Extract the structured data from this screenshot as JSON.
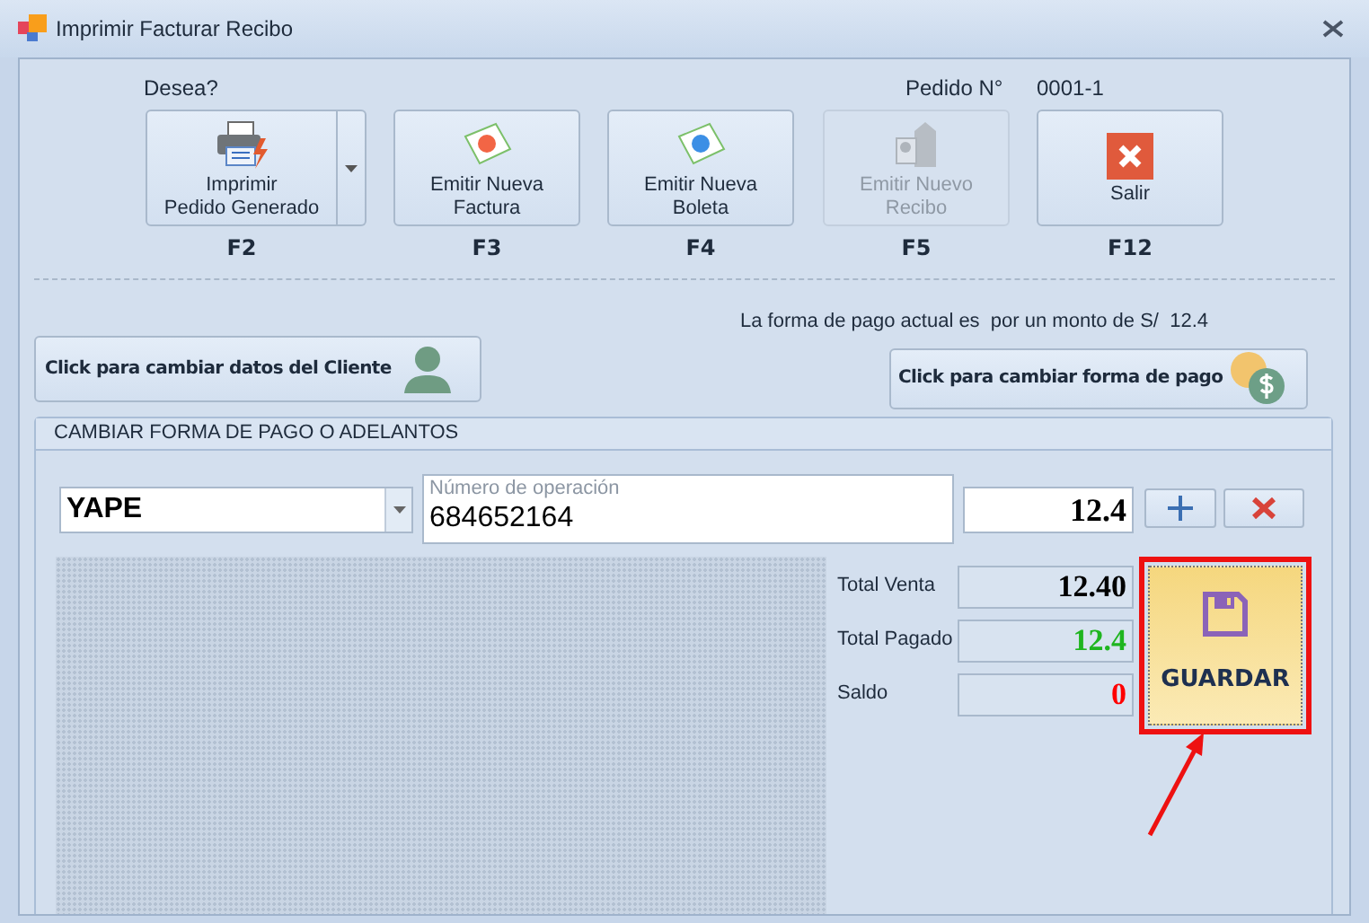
{
  "window": {
    "title": "Imprimir Facturar Recibo"
  },
  "header": {
    "prompt": "Desea?",
    "order_label": "Pedido N°",
    "order_number": "0001-1"
  },
  "actions": [
    {
      "kind": "split",
      "lines": [
        "Imprimir",
        "Pedido Generado"
      ],
      "key": "F2",
      "disabled": false
    },
    {
      "kind": "button",
      "lines": [
        "Emitir Nueva",
        "Factura"
      ],
      "key": "F3",
      "disabled": false
    },
    {
      "kind": "button",
      "lines": [
        "Emitir Nueva",
        "Boleta"
      ],
      "key": "F4",
      "disabled": false
    },
    {
      "kind": "button",
      "lines": [
        "Emitir Nuevo",
        "Recibo"
      ],
      "key": "F5",
      "disabled": true
    },
    {
      "kind": "button",
      "lines": [
        "Salir"
      ],
      "key": "F12",
      "disabled": false
    }
  ],
  "payment_info": "La forma de pago actual es  por un monto de S/  12.4",
  "client_button": "Click para cambiar datos del Cliente",
  "payment_button": "Click para cambiar forma de pago",
  "payment_group": {
    "title": "CAMBIAR FORMA DE PAGO O ADELANTOS",
    "method": "YAPE",
    "operation": {
      "label": "Número de operación",
      "value": "684652164"
    },
    "amount": "12.4",
    "totals": [
      {
        "label": "Total  Venta",
        "value": "12.40",
        "color": "#000000"
      },
      {
        "label": "Total Pagado",
        "value": "12.4",
        "color": "#1fb51f"
      },
      {
        "label": "Saldo",
        "value": "0",
        "color": "#ff0000"
      }
    ],
    "save_button": "GUARDAR"
  }
}
